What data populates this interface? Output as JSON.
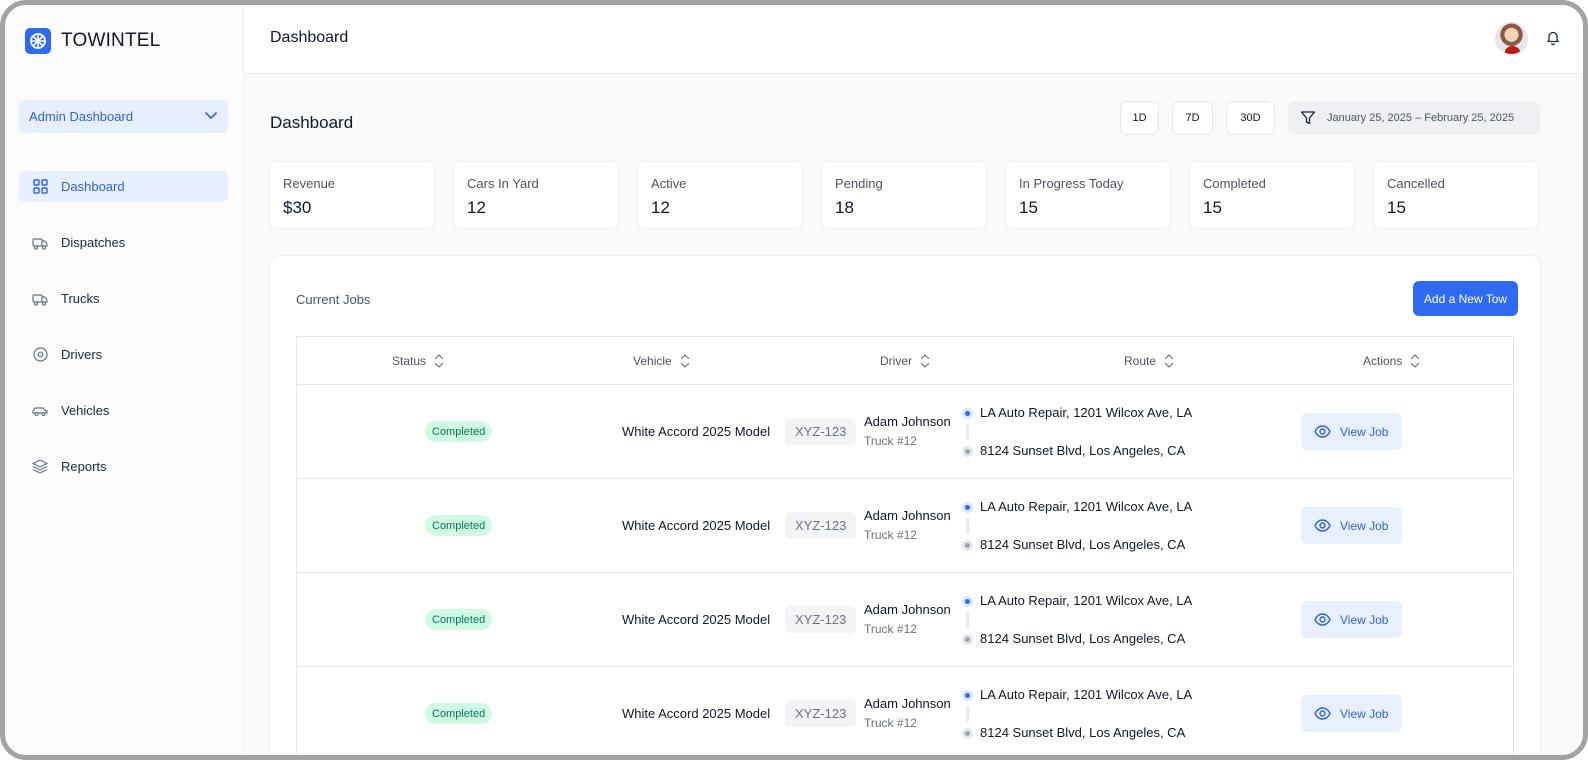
{
  "app": {
    "brand": "TOWINTEL",
    "accent": "#2f6bf2"
  },
  "sidebar": {
    "selector": "Admin Dashboard",
    "items": [
      {
        "label": "Dashboard",
        "icon": "grid-icon",
        "active": true
      },
      {
        "label": "Dispatches",
        "icon": "truck-icon"
      },
      {
        "label": "Trucks",
        "icon": "truck-icon"
      },
      {
        "label": "Drivers",
        "icon": "steering-wheel-icon"
      },
      {
        "label": "Vehicles",
        "icon": "car-icon"
      },
      {
        "label": "Reports",
        "icon": "layers-icon"
      }
    ]
  },
  "topbar": {
    "title": "Dashboard"
  },
  "main": {
    "title": "Dashboard",
    "ranges": [
      "1D",
      "7D",
      "30D"
    ],
    "date_range": "January 25, 2025 – February 25, 2025"
  },
  "stats": [
    {
      "label": "Revenue",
      "value": "$30"
    },
    {
      "label": "Cars In Yard",
      "value": "12"
    },
    {
      "label": "Active",
      "value": "12"
    },
    {
      "label": "Pending",
      "value": "18"
    },
    {
      "label": "In Progress Today",
      "value": "15"
    },
    {
      "label": "Completed",
      "value": "15"
    },
    {
      "label": "Cancelled",
      "value": "15"
    }
  ],
  "jobs": {
    "title": "Current Jobs",
    "add_button": "Add a New Tow",
    "columns": [
      "Status",
      "Vehicle",
      "Driver",
      "Route",
      "Actions"
    ],
    "rows": [
      {
        "status": "Completed",
        "vehicle": "White Accord 2025 Model",
        "plate": "XYZ-123",
        "driver": "Adam Johnson",
        "truck": "Truck #12",
        "from": "LA Auto Repair, 1201 Wilcox Ave, LA",
        "to": "8124 Sunset Blvd, Los Angeles, CA",
        "action": "View Job"
      },
      {
        "status": "Completed",
        "vehicle": "White Accord 2025 Model",
        "plate": "XYZ-123",
        "driver": "Adam Johnson",
        "truck": "Truck #12",
        "from": "LA Auto Repair, 1201 Wilcox Ave, LA",
        "to": "8124 Sunset Blvd, Los Angeles, CA",
        "action": "View Job"
      },
      {
        "status": "Completed",
        "vehicle": "White Accord 2025 Model",
        "plate": "XYZ-123",
        "driver": "Adam Johnson",
        "truck": "Truck #12",
        "from": "LA Auto Repair, 1201 Wilcox Ave, LA",
        "to": "8124 Sunset Blvd, Los Angeles, CA",
        "action": "View Job"
      },
      {
        "status": "Completed",
        "vehicle": "White Accord 2025 Model",
        "plate": "XYZ-123",
        "driver": "Adam Johnson",
        "truck": "Truck #12",
        "from": "LA Auto Repair, 1201 Wilcox Ave, LA",
        "to": "8124 Sunset Blvd, Los Angeles, CA",
        "action": "View Job"
      }
    ]
  }
}
